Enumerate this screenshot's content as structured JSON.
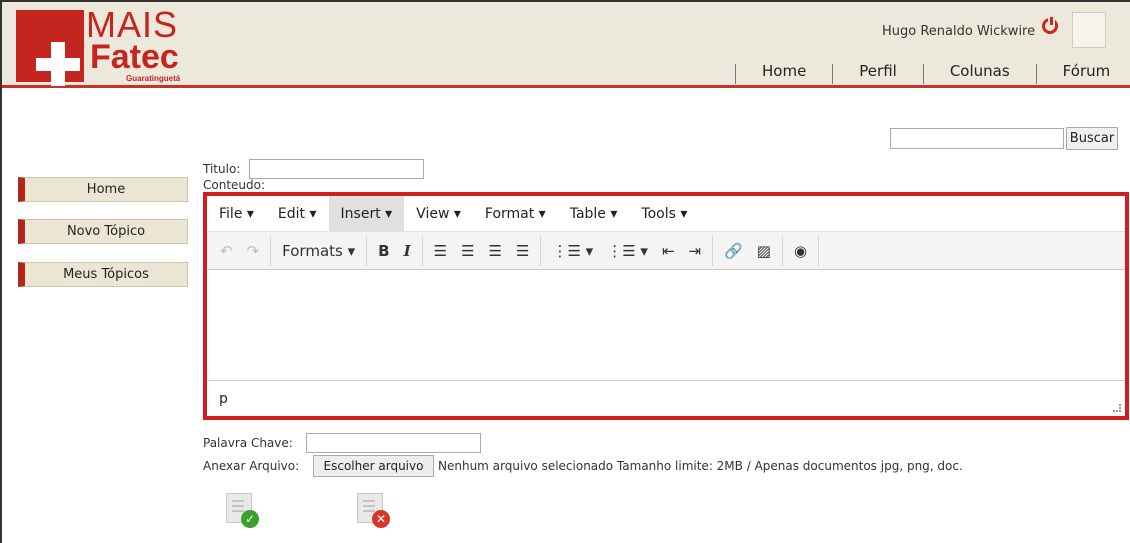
{
  "header": {
    "logo": {
      "line1": "MAIS",
      "line2": "Fatec",
      "city": "Guaratinguetá"
    },
    "user_name": "Hugo Renaldo Wickwire",
    "nav": [
      "Home",
      "Perfil",
      "Colunas",
      "Fórum"
    ]
  },
  "search": {
    "value": "",
    "button_label": "Buscar"
  },
  "sidebar": {
    "items": [
      "Home",
      "Novo Tópico",
      "Meus Tópicos"
    ]
  },
  "form": {
    "title_label": "Titulo:",
    "content_label": "Conteudo:",
    "keyword_label": "Palavra Chave:",
    "attach_label": "Anexar Arquivo:",
    "file_button": "Escolher arquivo",
    "file_status": "Nenhum arquivo selecionado Tamanho limite: 2MB / Apenas documentos jpg, png, doc."
  },
  "editor": {
    "menus": [
      "File",
      "Edit",
      "Insert",
      "View",
      "Format",
      "Table",
      "Tools"
    ],
    "active_menu": "Insert",
    "formats_label": "Formats",
    "status_path": "p"
  },
  "colors": {
    "brand_red": "#c4261f",
    "header_bg": "#ede8dc",
    "editor_border": "#d21d20"
  }
}
